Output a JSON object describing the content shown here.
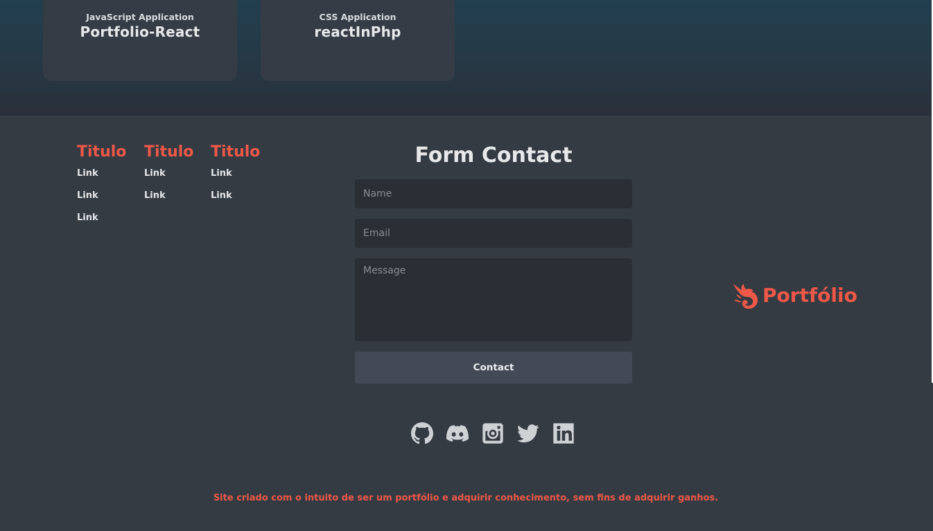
{
  "projects": [
    {
      "type": "JavaScript Application",
      "name": "Portfolio-React"
    },
    {
      "type": "CSS Application",
      "name": "reactInPhp"
    }
  ],
  "footer": {
    "columns": [
      {
        "title": "Titulo",
        "links": [
          "Link",
          "Link",
          "Link"
        ]
      },
      {
        "title": "Titulo",
        "links": [
          "Link",
          "Link"
        ]
      },
      {
        "title": "Titulo",
        "links": [
          "Link",
          "Link"
        ]
      }
    ],
    "form": {
      "title": "Form Contact",
      "name_placeholder": "Name",
      "email_placeholder": "Email",
      "message_placeholder": "Message",
      "submit_label": "Contact"
    },
    "brand": {
      "name": "Portfólio",
      "icon": "phoenix-logo-icon"
    },
    "socials": [
      {
        "icon": "github-icon"
      },
      {
        "icon": "discord-icon"
      },
      {
        "icon": "instagram-icon"
      },
      {
        "icon": "twitter-icon"
      },
      {
        "icon": "linkedin-icon"
      }
    ],
    "disclaimer": "Site criado com o intuito de ser um portfólio e adquirir conhecimento, sem fins de adquirir ganhos."
  },
  "colors": {
    "accent": "#ee5848",
    "background": "#353b43",
    "card": "#353c45",
    "input": "#2a2f36",
    "button": "#444a55"
  }
}
